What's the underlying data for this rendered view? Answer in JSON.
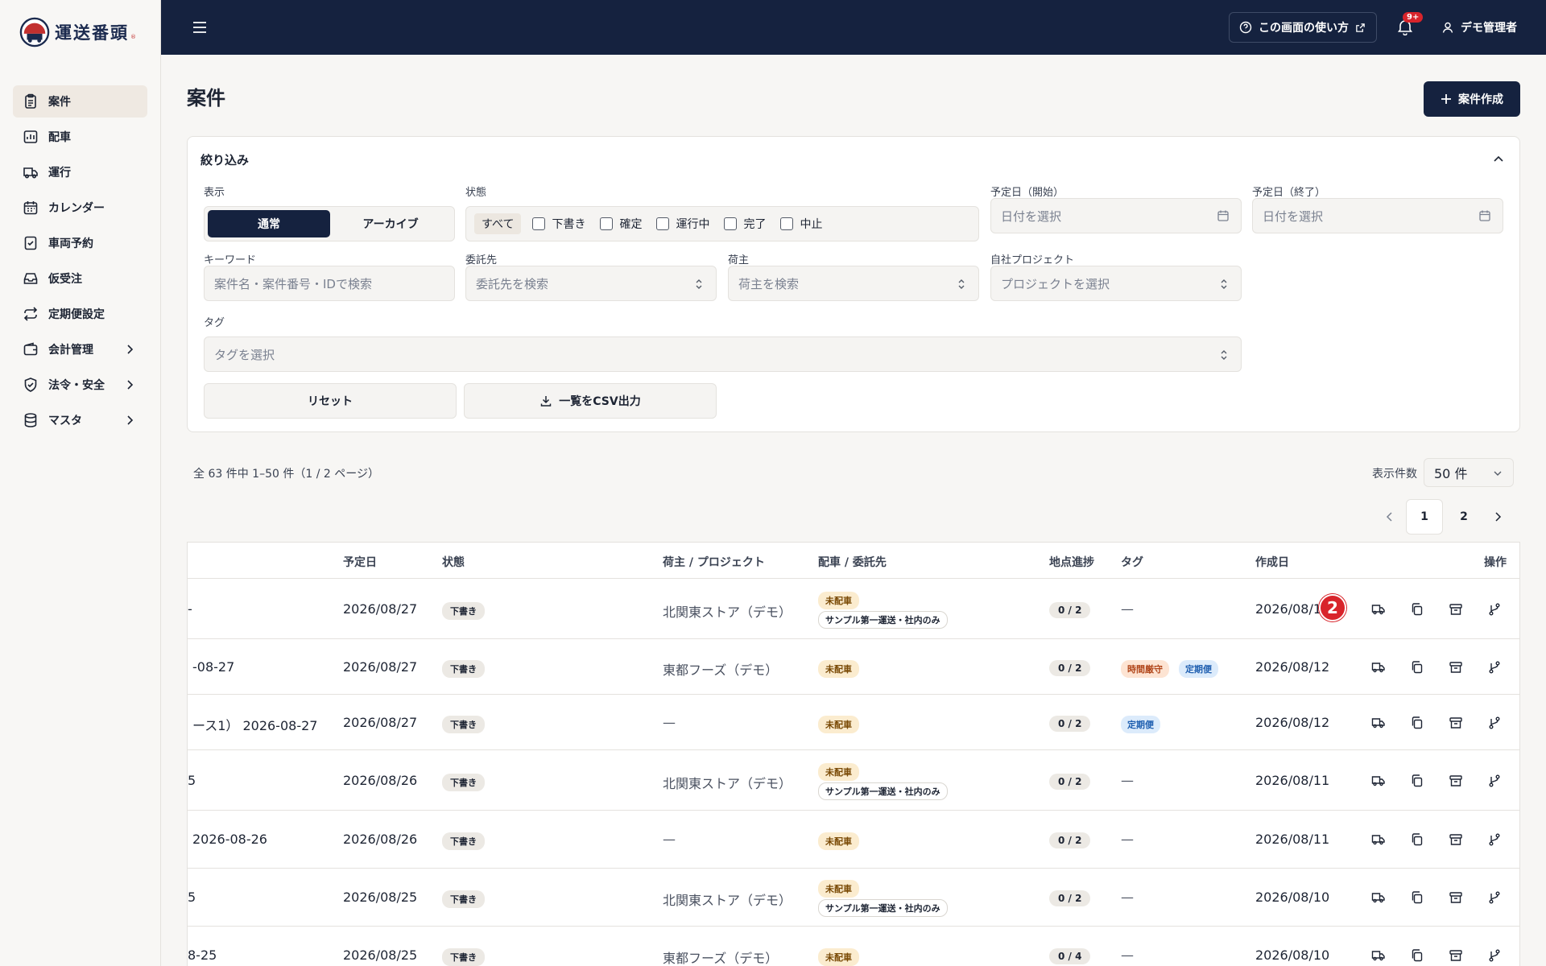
{
  "app": {
    "name": "運送番頭"
  },
  "sidebar": {
    "items": [
      {
        "label": "案件",
        "icon": "clipboard-icon",
        "active": true
      },
      {
        "label": "配車",
        "icon": "chart-board-icon"
      },
      {
        "label": "運行",
        "icon": "truck-icon"
      },
      {
        "label": "カレンダー",
        "icon": "calendar-icon"
      },
      {
        "label": "車両予約",
        "icon": "calendar-check-icon"
      },
      {
        "label": "仮受注",
        "icon": "inbox-icon"
      },
      {
        "label": "定期便設定",
        "icon": "repeat-icon"
      },
      {
        "label": "会計管理",
        "icon": "wallet-icon",
        "expandable": true
      },
      {
        "label": "法令・安全",
        "icon": "shield-icon",
        "expandable": true
      },
      {
        "label": "マスタ",
        "icon": "database-icon",
        "expandable": true
      }
    ]
  },
  "topbar": {
    "help_label": "この画面の使い方",
    "notification_badge": "9+",
    "user_name": "デモ管理者"
  },
  "page": {
    "title": "案件",
    "create_button": "案件作成"
  },
  "filters": {
    "title": "絞り込み",
    "view_label": "表示",
    "view_options": [
      "通常",
      "アーカイブ"
    ],
    "status_label": "状態",
    "status_all": "すべて",
    "status_options": [
      "下書き",
      "確定",
      "運行中",
      "完了",
      "中止"
    ],
    "date_start_label": "予定日（開始）",
    "date_start_placeholder": "日付を選択",
    "date_end_label": "予定日（終了）",
    "date_end_placeholder": "日付を選択",
    "keyword_label": "キーワード",
    "keyword_placeholder": "案件名・案件番号・IDで検索",
    "consignor_label": "委託先",
    "consignor_placeholder": "委託先を検索",
    "shipper_label": "荷主",
    "shipper_placeholder": "荷主を検索",
    "project_label": "自社プロジェクト",
    "project_placeholder": "プロジェクトを選択",
    "tag_label": "タグ",
    "tag_placeholder": "タグを選択",
    "reset_button": "リセット",
    "csv_button": "一覧をCSV出力"
  },
  "list": {
    "summary": "全 63 件中 1–50 件（1 / 2 ページ）",
    "per_page_label": "表示件数",
    "per_page_value": "50 件",
    "pages": [
      "1",
      "2"
    ],
    "current_page": "1"
  },
  "table": {
    "headers": {
      "date": "予定日",
      "status": "状態",
      "shipper": "荷主 / プロジェクト",
      "dispatch": "配車 / 委託先",
      "progress": "地点進捗",
      "tags": "タグ",
      "created": "作成日",
      "actions": "操作"
    },
    "rows": [
      {
        "name_tail": "-",
        "date": "2026/08/27",
        "status": "下書き",
        "shipper": "北関東ストア（デモ）",
        "dispatch": "未配車",
        "carrier": "サンプル第一運送・社内のみ",
        "progress": "0 / 2",
        "tags": [],
        "created": "2026/08/1"
      },
      {
        "name_tail": "-08-27",
        "date": "2026/08/27",
        "status": "下書き",
        "shipper": "東都フーズ（デモ）",
        "dispatch": "未配車",
        "carrier": "",
        "progress": "0 / 2",
        "tags": [
          "時間厳守",
          "定期便"
        ],
        "created": "2026/08/12"
      },
      {
        "name_tail": "ース1） 2026-08-27",
        "date": "2026/08/27",
        "status": "下書き",
        "shipper": "—",
        "dispatch": "未配車",
        "carrier": "",
        "progress": "0 / 2",
        "tags": [
          "定期便"
        ],
        "created": "2026/08/12"
      },
      {
        "name_tail": "5",
        "date": "2026/08/26",
        "status": "下書き",
        "shipper": "北関東ストア（デモ）",
        "dispatch": "未配車",
        "carrier": "サンプル第一運送・社内のみ",
        "progress": "0 / 2",
        "tags": [],
        "created": "2026/08/11"
      },
      {
        "name_tail": "2026-08-26",
        "date": "2026/08/26",
        "status": "下書き",
        "shipper": "—",
        "dispatch": "未配車",
        "carrier": "",
        "progress": "0 / 2",
        "tags": [],
        "created": "2026/08/11"
      },
      {
        "name_tail": "5",
        "date": "2026/08/25",
        "status": "下書き",
        "shipper": "北関東ストア（デモ）",
        "dispatch": "未配車",
        "carrier": "サンプル第一運送・社内のみ",
        "progress": "0 / 2",
        "tags": [],
        "created": "2026/08/10"
      },
      {
        "name_tail": "8-25",
        "date": "2026/08/25",
        "status": "下書き",
        "shipper": "東都フーズ（デモ）",
        "dispatch": "未配車",
        "carrier": "",
        "progress": "0 / 4",
        "tags": [],
        "created": "2026/08/10"
      }
    ],
    "empty_value": "—"
  },
  "overlay": {
    "marker": "2"
  },
  "colors": {
    "navy": "#15223f",
    "accent_red": "#d8242b",
    "unassigned_bg": "#fbeccf",
    "regular_bg": "#dcebfb",
    "time_bg": "#fde4d3"
  }
}
